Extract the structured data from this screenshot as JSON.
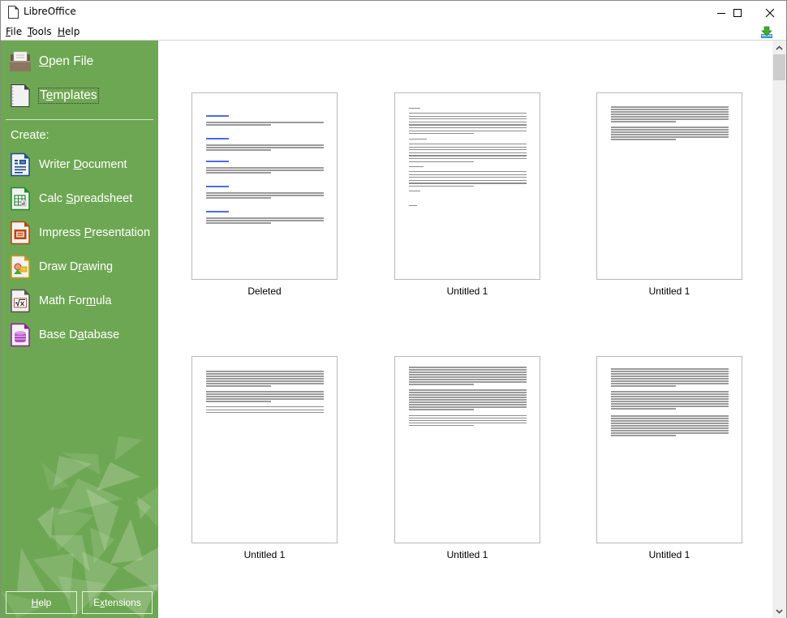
{
  "window": {
    "title": "LibreOffice",
    "controls": {
      "minimize": "minimize-icon",
      "maximize": "maximize-icon",
      "close": "close-icon"
    }
  },
  "menubar": {
    "items": [
      {
        "label": "File",
        "mnemonic": "F",
        "rest": "ile"
      },
      {
        "label": "Tools",
        "mnemonic": "T",
        "rest": "ools"
      },
      {
        "label": "Help",
        "mnemonic": "H",
        "rest": "elp"
      }
    ],
    "update_icon": "update-download-icon"
  },
  "sidebar": {
    "open_file": {
      "label": "Open File",
      "mnemonic": "O",
      "rest": "pen File",
      "icon": "folder-icon"
    },
    "templates": {
      "label": "Templates",
      "pre": "T",
      "mnemonic": "e",
      "rest": "mplates",
      "icon": "template-icon"
    },
    "create_label": "Create:",
    "create_items": [
      {
        "label": "Writer Document",
        "pre": "Writer ",
        "mnemonic": "D",
        "rest": "ocument",
        "icon": "writer-icon",
        "color": "#1c4f8c"
      },
      {
        "label": "Calc Spreadsheet",
        "pre": "Calc ",
        "mnemonic": "S",
        "rest": "preadsheet",
        "icon": "calc-icon",
        "color": "#1f8a2d"
      },
      {
        "label": "Impress Presentation",
        "pre": "Impress ",
        "mnemonic": "P",
        "rest": "resentation",
        "icon": "impress-icon",
        "color": "#b8470f"
      },
      {
        "label": "Draw Drawing",
        "pre": "Draw D",
        "mnemonic": "r",
        "rest": "awing",
        "icon": "draw-icon",
        "color": "#c99a16"
      },
      {
        "label": "Math Formula",
        "pre": "Math For",
        "mnemonic": "m",
        "rest": "ula",
        "icon": "math-icon",
        "color": "#555555"
      },
      {
        "label": "Base Database",
        "pre": "Base D",
        "mnemonic": "a",
        "rest": "tabase",
        "icon": "base-icon",
        "color": "#8b1f9c"
      }
    ],
    "buttons": {
      "help": {
        "label": "Help",
        "mnemonic": "H",
        "rest": "elp"
      },
      "extensions": {
        "label": "Extensions",
        "pre": "E",
        "mnemonic": "x",
        "rest": "tensions"
      }
    },
    "background_color": "#6ea753"
  },
  "recent_documents": [
    {
      "name": "Deleted",
      "style": "links"
    },
    {
      "name": "Untitled 1",
      "style": "serif"
    },
    {
      "name": "Untitled 1",
      "style": "dense"
    },
    {
      "name": "Untitled 1",
      "style": "mixed"
    },
    {
      "name": "Untitled 1",
      "style": "paragraphs"
    },
    {
      "name": "Untitled 1",
      "style": "longtext"
    }
  ]
}
